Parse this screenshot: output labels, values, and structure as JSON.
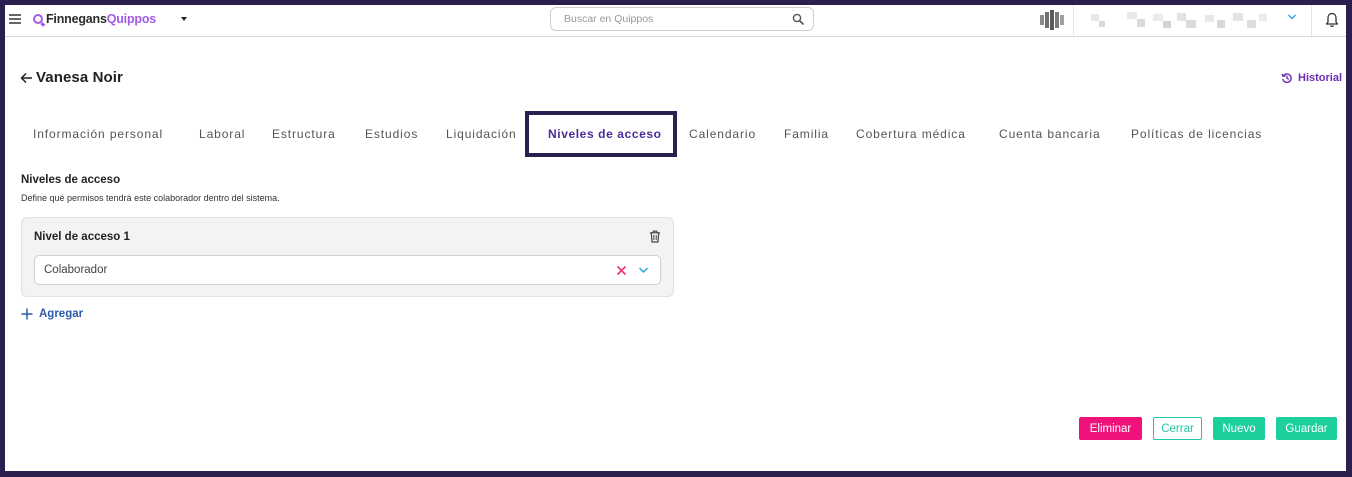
{
  "topbar": {
    "logo_part1": "Finnegans",
    "logo_part2": "Quippos",
    "search_placeholder": "Buscar en Quippos"
  },
  "header": {
    "title": "Vanesa Noir",
    "historial_label": "Historial"
  },
  "tabs": [
    {
      "label": "Información personal",
      "active": false
    },
    {
      "label": "Laboral",
      "active": false
    },
    {
      "label": "Estructura",
      "active": false
    },
    {
      "label": "Estudios",
      "active": false
    },
    {
      "label": "Liquidación",
      "active": false
    },
    {
      "label": "Niveles de acceso",
      "active": true
    },
    {
      "label": "Calendario",
      "active": false
    },
    {
      "label": "Familia",
      "active": false
    },
    {
      "label": "Cobertura médica",
      "active": false
    },
    {
      "label": "Cuenta bancaria",
      "active": false
    },
    {
      "label": "Políticas de licencias",
      "active": false
    }
  ],
  "section": {
    "title": "Niveles de acceso",
    "description": "Define qué permisos tendrá este colaborador dentro del sistema.",
    "card_title": "Nivel de acceso 1",
    "select_value": "Colaborador",
    "add_label": "Agregar"
  },
  "footer": {
    "eliminar": "Eliminar",
    "cerrar": "Cerrar",
    "nuevo": "Nuevo",
    "guardar": "Guardar"
  },
  "colors": {
    "brand_purple": "#a45ae6",
    "frame": "#2a1f4e",
    "danger": "#f0127a",
    "success": "#1ccf9c",
    "link_blue": "#2a5aa8"
  }
}
